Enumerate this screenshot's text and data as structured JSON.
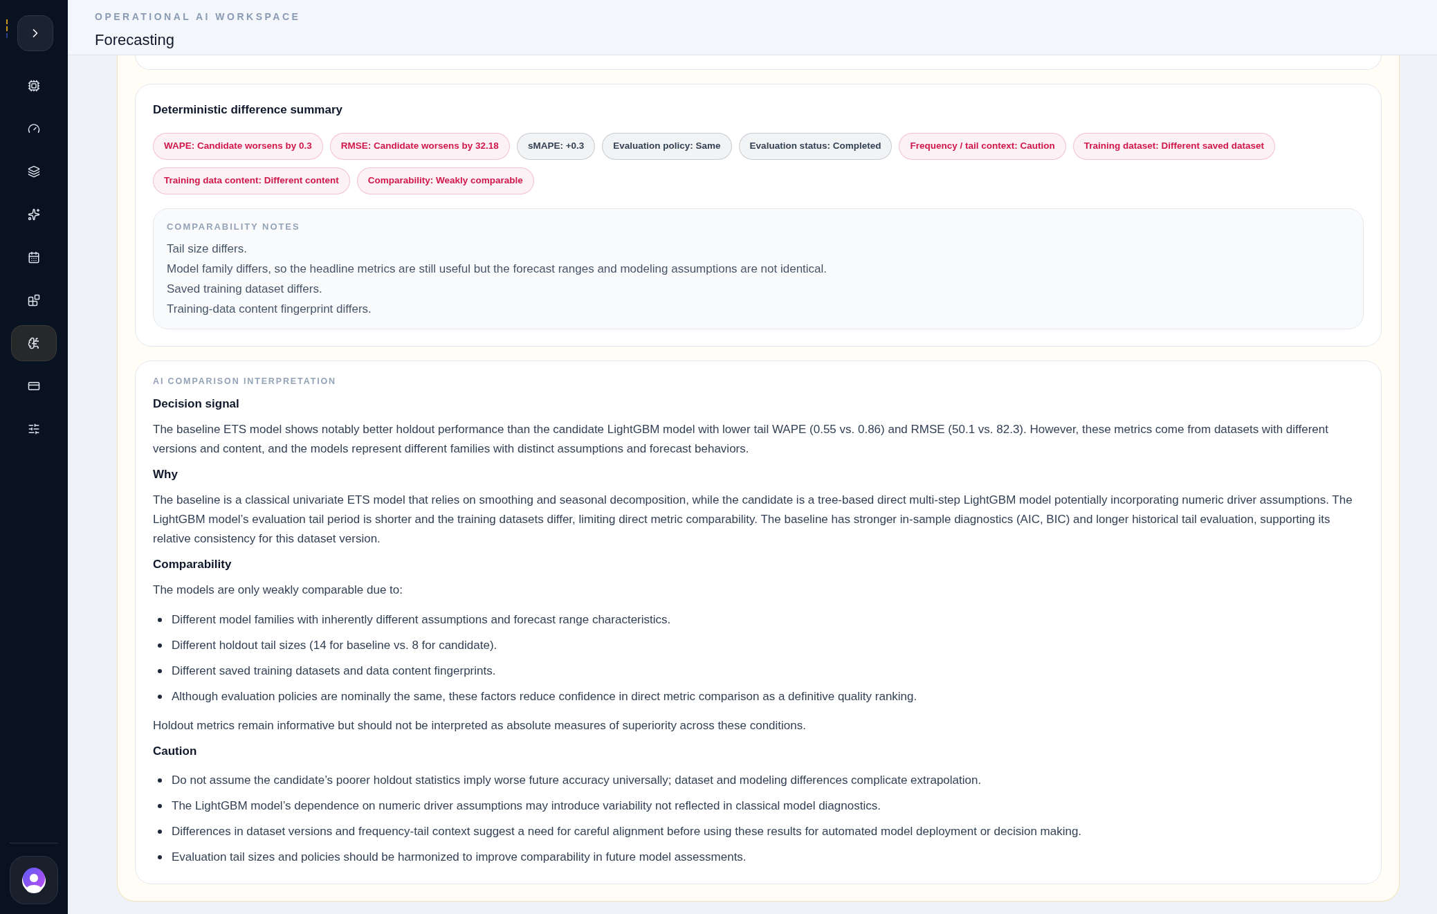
{
  "sidebar": {
    "items": [
      {
        "selected": false
      },
      {
        "selected": false
      },
      {
        "selected": false
      },
      {
        "selected": false
      },
      {
        "selected": false
      },
      {
        "selected": false
      },
      {
        "selected": true
      },
      {
        "selected": false
      },
      {
        "selected": false
      }
    ]
  },
  "header": {
    "eyebrow": "OPERATIONAL AI WORKSPACE",
    "title": "Forecasting"
  },
  "difference_summary": {
    "title": "Deterministic difference summary",
    "chips": [
      {
        "label": "WAPE: Candidate worsens by 0.3",
        "color": "#d1184a"
      },
      {
        "label": "RMSE: Candidate worsens by 32.18",
        "color": "#d1184a"
      },
      {
        "label": "sMAPE: +0.3",
        "color": "#334155"
      },
      {
        "label": "Evaluation policy: Same",
        "color": "#334155"
      },
      {
        "label": "Evaluation status: Completed",
        "color": "#334155"
      },
      {
        "label": "Frequency / tail context: Caution",
        "color": "#d1184a"
      },
      {
        "label": "Training dataset: Different saved dataset",
        "color": "#d1184a"
      },
      {
        "label": "Training data content: Different content",
        "color": "#d1184a"
      },
      {
        "label": "Comparability: Weakly comparable",
        "color": "#d1184a"
      }
    ],
    "notes": {
      "title": "COMPARABILITY NOTES",
      "lines": [
        "Tail size differs.",
        "Model family differs, so the headline metrics are still useful but the forecast ranges and modeling assumptions are not identical.",
        "Saved training dataset differs.",
        "Training-data content fingerprint differs."
      ]
    }
  },
  "interpretation": {
    "eyebrow": "AI COMPARISON INTERPRETATION",
    "blocks": [
      {
        "kind": "heading",
        "text": "Decision signal"
      },
      {
        "kind": "paragraph",
        "text": "The baseline ETS model shows notably better holdout performance than the candidate LightGBM model with lower tail WAPE (0.55 vs. 0.86) and RMSE (50.1 vs. 82.3). However, these metrics come from datasets with different versions and content, and the models represent different families with distinct assumptions and forecast behaviors."
      },
      {
        "kind": "heading",
        "text": "Why"
      },
      {
        "kind": "paragraph",
        "text": "The baseline is a classical univariate ETS model that relies on smoothing and seasonal decomposition, while the candidate is a tree-based direct multi-step LightGBM model potentially incorporating numeric driver assumptions. The LightGBM model’s evaluation tail period is shorter and the training datasets differ, limiting direct metric comparability. The baseline has stronger in-sample diagnostics (AIC, BIC) and longer historical tail evaluation, supporting its relative consistency for this dataset version."
      },
      {
        "kind": "heading",
        "text": "Comparability"
      },
      {
        "kind": "paragraph",
        "text": "The models are only weakly comparable due to:"
      },
      {
        "kind": "bullets",
        "items": [
          "Different model families with inherently different assumptions and forecast range characteristics.",
          "Different holdout tail sizes (14 for baseline vs. 8 for candidate).",
          "Different saved training datasets and data content fingerprints.",
          "Although evaluation policies are nominally the same, these factors reduce confidence in direct metric comparison as a definitive quality ranking."
        ]
      },
      {
        "kind": "paragraph",
        "text": "Holdout metrics remain informative but should not be interpreted as absolute measures of superiority across these conditions."
      },
      {
        "kind": "heading",
        "text": "Caution"
      },
      {
        "kind": "bullets",
        "items": [
          "Do not assume the candidate’s poorer holdout statistics imply worse future accuracy universally; dataset and modeling differences complicate extrapolation.",
          "The LightGBM model’s dependence on numeric driver assumptions may introduce variability not reflected in classical model diagnostics.",
          "Differences in dataset versions and frequency-tail context suggest a need for careful alignment before using these results for automated model deployment or decision making.",
          "Evaluation tail sizes and policies should be harmonized to improve comparability in future model assessments."
        ]
      }
    ]
  }
}
